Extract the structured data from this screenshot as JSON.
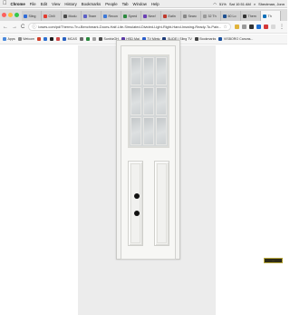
{
  "menubar": {
    "app": "Chrome",
    "items": [
      "File",
      "Edit",
      "View",
      "History",
      "Bookmarks",
      "People",
      "Tab",
      "Window",
      "Help"
    ],
    "status": [
      "51%",
      "Sat 10:51 AM",
      "Shectman, Jonn"
    ]
  },
  "tabs": [
    {
      "label": "Sling",
      "color": "#2f6bd8",
      "active": false
    },
    {
      "label": "Chili",
      "color": "#e33b2e",
      "active": false
    },
    {
      "label": "Modu",
      "color": "#4a4a4a",
      "active": false
    },
    {
      "label": "Team",
      "color": "#5b5fc7",
      "active": false
    },
    {
      "label": "Recon",
      "color": "#3c78d8",
      "active": false
    },
    {
      "label": "Spred",
      "color": "#2a8a3e",
      "active": false
    },
    {
      "label": "New!",
      "color": "#6a3fb5",
      "active": false
    },
    {
      "label": "Eatin",
      "color": "#c0392b",
      "active": false
    },
    {
      "label": "Searc",
      "color": "#888888",
      "active": false
    },
    {
      "label": "32 Th",
      "color": "#999999",
      "active": false
    },
    {
      "label": "60 Lo",
      "color": "#1d4f91",
      "active": false
    },
    {
      "label": "Them",
      "color": "#333333",
      "active": false
    },
    {
      "label": "Th",
      "color": "#0d6fb8",
      "active": true
    }
  ],
  "toolbar": {
    "back": "←",
    "forward": "→",
    "reload": "C",
    "url": "lowes.com/pd/Thermo-Tru-Benchmark-Doors-Half-Lite-Simulated-Divided-Light-Right-Hand-Inswing-Ready-To-Pain...",
    "extension_colors": [
      "#e0b33a",
      "#9a9a9a",
      "#333333",
      "#1f6fd1",
      "#d43838",
      "#d8d8d8"
    ]
  },
  "bookmarks": [
    {
      "label": "Apps",
      "color": "#4a89dc"
    },
    {
      "label": "Welcom",
      "color": "#888888"
    },
    {
      "label": "",
      "color": "#d0402b"
    },
    {
      "label": "",
      "color": "#2e6fd0"
    },
    {
      "label": "",
      "color": "#1f1f1f"
    },
    {
      "label": "",
      "color": "#d04848"
    },
    {
      "label": "MCAS",
      "color": "#2961c2"
    },
    {
      "label": "",
      "color": "#6b6b6b"
    },
    {
      "label": "",
      "color": "#2a8a3e"
    },
    {
      "label": "",
      "color": "#a0a0a0"
    },
    {
      "label": "SunbizOH",
      "color": "#4a4a4a"
    },
    {
      "label": "HSD Mai",
      "color": "#5c3aa8"
    },
    {
      "label": "TV Minty",
      "color": "#2b5fd0"
    },
    {
      "label": "SLIDE | Sling TV",
      "color": "#1d3c7a"
    },
    {
      "label": "Bookmarks",
      "color": "#444444"
    },
    {
      "label": "VISBORO Canvas...",
      "color": "#1a4f9c"
    }
  ],
  "product": {
    "badge_text": "···",
    "door_color": "#f7f7f5",
    "glass_pane_count": 9
  }
}
